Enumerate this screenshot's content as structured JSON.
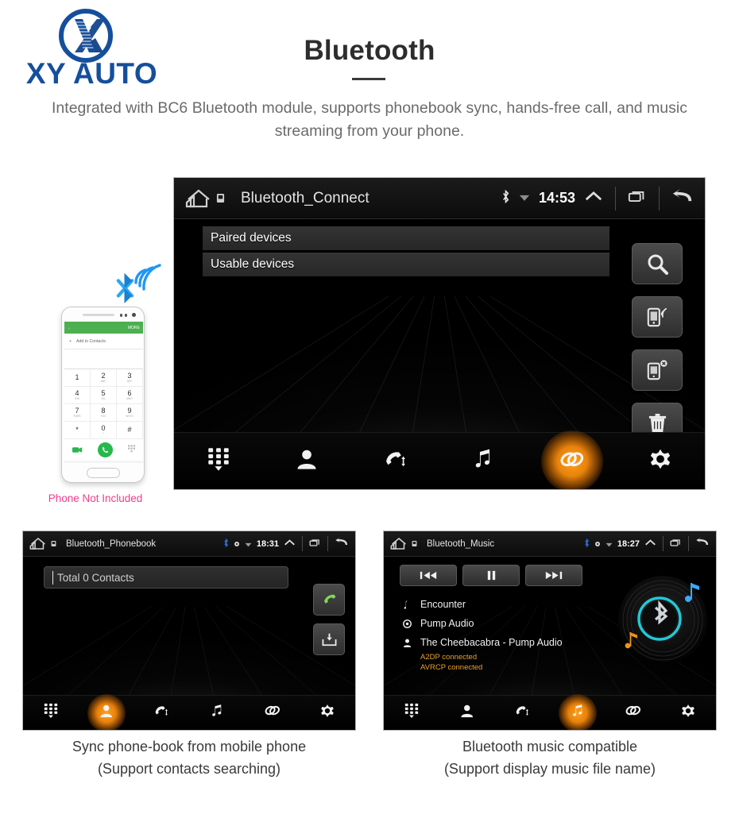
{
  "brand": {
    "name": "XY AUTO",
    "color": "#154f9c",
    "logo_icon": "xy-circle-logo"
  },
  "header": {
    "title": "Bluetooth",
    "subtitle": "Integrated with BC6 Bluetooth module, supports phonebook sync, hands-free call, and music streaming from your phone."
  },
  "phone_mockup": {
    "caption": "Phone Not Included",
    "caption_color": "#ef3e8a",
    "screen": {
      "more_label": "MORE",
      "add_contacts_label": "Add to Contacts",
      "keys": [
        {
          "digit": "1",
          "sub": ""
        },
        {
          "digit": "2",
          "sub": "ABC"
        },
        {
          "digit": "3",
          "sub": "DEF"
        },
        {
          "digit": "4",
          "sub": "GHI"
        },
        {
          "digit": "5",
          "sub": "JKL"
        },
        {
          "digit": "6",
          "sub": "MNO"
        },
        {
          "digit": "7",
          "sub": "PQRS"
        },
        {
          "digit": "8",
          "sub": "TUV"
        },
        {
          "digit": "9",
          "sub": "WXYZ"
        },
        {
          "digit": "*",
          "sub": ""
        },
        {
          "digit": "0",
          "sub": "+"
        },
        {
          "digit": "#",
          "sub": ""
        }
      ]
    }
  },
  "main_screen": {
    "status": {
      "title": "Bluetooth_Connect",
      "time": "14:53",
      "icons": [
        "home-icon",
        "bluetooth-icon",
        "wifi-icon",
        "chevron-up-icon",
        "recents-icon",
        "back-icon"
      ]
    },
    "device_sections": [
      {
        "label": "Paired devices"
      },
      {
        "label": "Usable devices"
      }
    ],
    "rail_buttons": [
      {
        "name": "search-devices-button",
        "icon": "search-icon"
      },
      {
        "name": "connect-device-button",
        "icon": "phone-connect-icon"
      },
      {
        "name": "disconnect-device-button",
        "icon": "phone-disconnect-icon"
      },
      {
        "name": "delete-device-button",
        "icon": "trash-icon"
      }
    ],
    "nav": [
      {
        "name": "nav-dialpad",
        "icon": "dialpad-icon",
        "active": false
      },
      {
        "name": "nav-contacts",
        "icon": "contact-icon",
        "active": false
      },
      {
        "name": "nav-call-history",
        "icon": "call-history-icon",
        "active": false
      },
      {
        "name": "nav-music",
        "icon": "music-note-icon",
        "active": false
      },
      {
        "name": "nav-link",
        "icon": "link-icon",
        "active": true
      },
      {
        "name": "nav-settings",
        "icon": "gear-icon",
        "active": false
      }
    ]
  },
  "phonebook_screen": {
    "status": {
      "title": "Bluetooth_Phonebook",
      "time": "18:31"
    },
    "search_value": "Total 0 Contacts",
    "rail_buttons": [
      {
        "name": "dial-call-button",
        "icon": "green-phone-icon"
      },
      {
        "name": "download-contacts-button",
        "icon": "download-icon"
      }
    ],
    "nav": [
      {
        "name": "nav-dialpad",
        "icon": "dialpad-icon",
        "active": false
      },
      {
        "name": "nav-contacts",
        "icon": "contact-icon",
        "active": true
      },
      {
        "name": "nav-call-history",
        "icon": "call-history-icon",
        "active": false
      },
      {
        "name": "nav-music",
        "icon": "music-note-icon",
        "active": false
      },
      {
        "name": "nav-link",
        "icon": "link-icon",
        "active": false
      },
      {
        "name": "nav-settings",
        "icon": "gear-icon",
        "active": false
      }
    ],
    "caption_line1": "Sync phone-book from mobile phone",
    "caption_line2": "(Support contacts searching)"
  },
  "music_screen": {
    "status": {
      "title": "Bluetooth_Music",
      "time": "18:27"
    },
    "transport": [
      {
        "name": "previous-track-button",
        "icon": "prev-icon"
      },
      {
        "name": "pause-button",
        "icon": "pause-icon"
      },
      {
        "name": "next-track-button",
        "icon": "next-icon"
      }
    ],
    "track": {
      "title": "Encounter",
      "album": "Pump Audio",
      "artist": "The Cheebacabra - Pump Audio",
      "a2dp_status": "A2DP connected",
      "avrcp_status": "AVRCP connected",
      "status_color": "#e8a12c"
    },
    "nav": [
      {
        "name": "nav-dialpad",
        "icon": "dialpad-icon",
        "active": false
      },
      {
        "name": "nav-contacts",
        "icon": "contact-icon",
        "active": false
      },
      {
        "name": "nav-call-history",
        "icon": "call-history-icon",
        "active": false
      },
      {
        "name": "nav-music",
        "icon": "music-note-icon",
        "active": true
      },
      {
        "name": "nav-link",
        "icon": "link-icon",
        "active": false
      },
      {
        "name": "nav-settings",
        "icon": "gear-icon",
        "active": false
      }
    ],
    "caption_line1": "Bluetooth music compatible",
    "caption_line2": "(Support display music file name)"
  }
}
